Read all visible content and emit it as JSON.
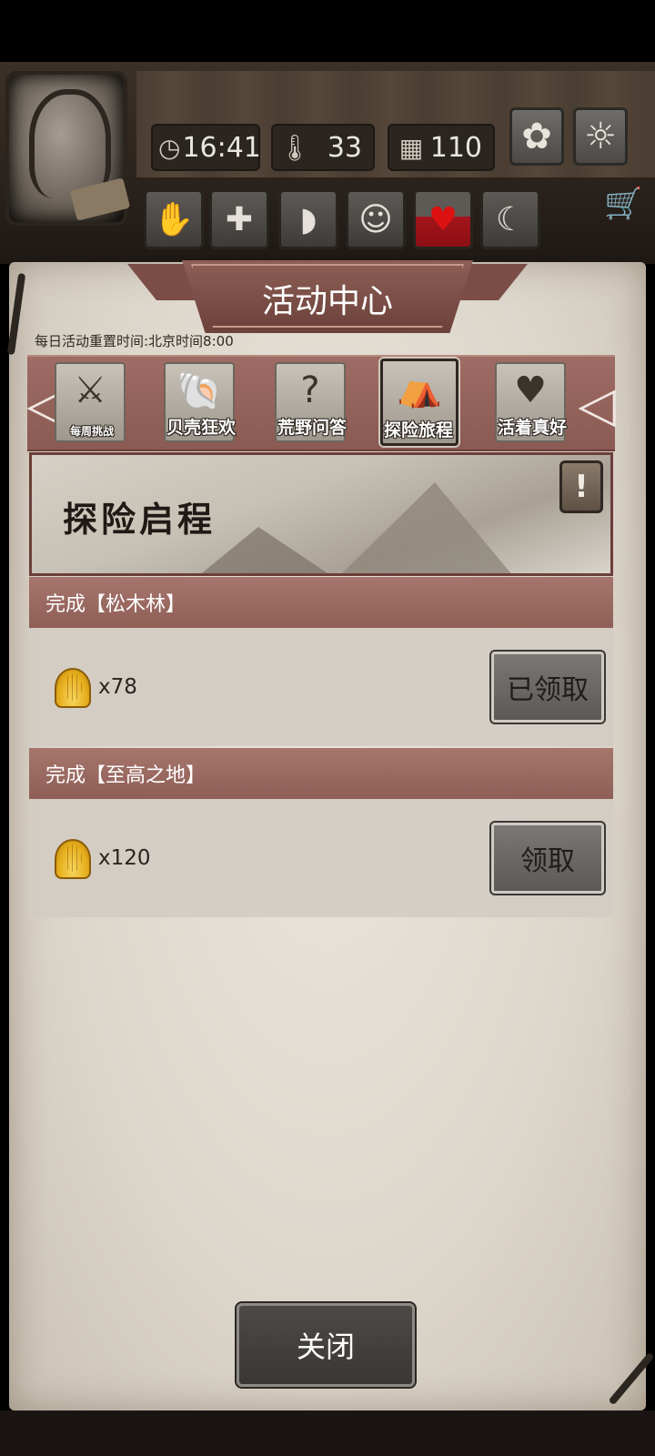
{
  "hud": {
    "time": "16:41",
    "temperature": "33",
    "day": "110"
  },
  "panel": {
    "title": "活动中心",
    "reset_note": "每日活动重置时间:北京时间8:00"
  },
  "tabs": [
    {
      "label": "每周挑战",
      "glyph": "⚔"
    },
    {
      "label": "贝壳狂欢",
      "glyph": "🐚"
    },
    {
      "label": "荒野问答",
      "glyph": "?"
    },
    {
      "label": "探险旅程",
      "glyph": "⛺"
    },
    {
      "label": "活着真好",
      "glyph": "♥"
    }
  ],
  "hero": {
    "title": "探险启程",
    "info": "!"
  },
  "tasks": [
    {
      "header": "完成【松木林】",
      "reward": "x78",
      "button": "已领取"
    },
    {
      "header": "完成【至高之地】",
      "reward": "x120",
      "button": "领取"
    }
  ],
  "footer": {
    "close": "关闭"
  },
  "colors": {
    "banner": "#8d5f56",
    "tab_strip": "#9e6c64",
    "parchment": "#e3ddd3",
    "shell_gold": "#e6ae1d"
  }
}
